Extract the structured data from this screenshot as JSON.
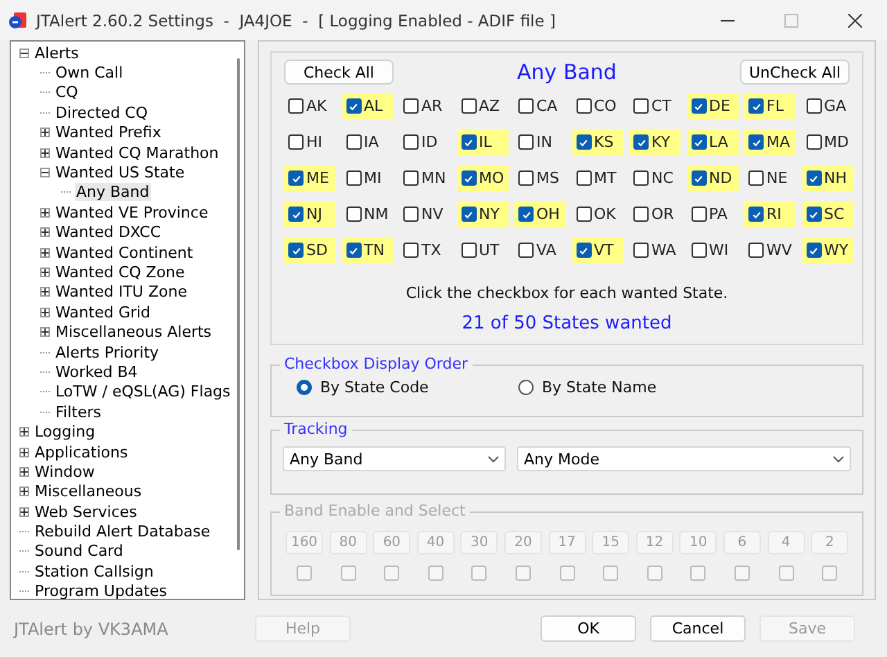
{
  "window": {
    "title": "JTAlert 2.60.2 Settings  -  JA4JOE  -  [ Logging Enabled - ADIF file ]"
  },
  "tree": [
    {
      "label": "Alerts",
      "expanded": true,
      "selected": false,
      "children": [
        {
          "label": "Own Call",
          "selected": false
        },
        {
          "label": "CQ",
          "selected": false
        },
        {
          "label": "Directed CQ",
          "selected": false
        },
        {
          "label": "Wanted Prefix",
          "expanded": false,
          "selected": false
        },
        {
          "label": "Wanted CQ Marathon",
          "expanded": false,
          "selected": false
        },
        {
          "label": "Wanted US State",
          "expanded": true,
          "selected": false,
          "children": [
            {
              "label": "Any Band",
              "selected": true
            }
          ]
        },
        {
          "label": "Wanted VE Province",
          "expanded": false,
          "selected": false
        },
        {
          "label": "Wanted DXCC",
          "expanded": false,
          "selected": false
        },
        {
          "label": "Wanted Continent",
          "expanded": false,
          "selected": false
        },
        {
          "label": "Wanted CQ Zone",
          "expanded": false,
          "selected": false
        },
        {
          "label": "Wanted ITU Zone",
          "expanded": false,
          "selected": false
        },
        {
          "label": "Wanted Grid",
          "expanded": false,
          "selected": false
        },
        {
          "label": "Miscellaneous Alerts",
          "expanded": false,
          "selected": false
        },
        {
          "label": "Alerts Priority",
          "selected": false
        },
        {
          "label": "Worked B4",
          "selected": false
        },
        {
          "label": "LoTW / eQSL(AG) Flags",
          "selected": false
        },
        {
          "label": "Filters",
          "selected": false
        }
      ]
    },
    {
      "label": "Logging",
      "expanded": false,
      "selected": false
    },
    {
      "label": "Applications",
      "expanded": false,
      "selected": false
    },
    {
      "label": "Window",
      "expanded": false,
      "selected": false
    },
    {
      "label": "Miscellaneous",
      "expanded": false,
      "selected": false
    },
    {
      "label": "Web Services",
      "expanded": false,
      "selected": false
    },
    {
      "label": "Rebuild Alert Database",
      "selected": false
    },
    {
      "label": "Sound Card",
      "selected": false
    },
    {
      "label": "Station Callsign",
      "selected": false
    },
    {
      "label": "Program Updates",
      "selected": false
    }
  ],
  "states_panel": {
    "check_all": "Check All",
    "heading": "Any Band",
    "uncheck_all": "UnCheck All",
    "states": [
      {
        "code": "AK",
        "checked": false
      },
      {
        "code": "AL",
        "checked": true
      },
      {
        "code": "AR",
        "checked": false
      },
      {
        "code": "AZ",
        "checked": false
      },
      {
        "code": "CA",
        "checked": false
      },
      {
        "code": "CO",
        "checked": false
      },
      {
        "code": "CT",
        "checked": false
      },
      {
        "code": "DE",
        "checked": true
      },
      {
        "code": "FL",
        "checked": true
      },
      {
        "code": "GA",
        "checked": false
      },
      {
        "code": "HI",
        "checked": false
      },
      {
        "code": "IA",
        "checked": false
      },
      {
        "code": "ID",
        "checked": false
      },
      {
        "code": "IL",
        "checked": true
      },
      {
        "code": "IN",
        "checked": false
      },
      {
        "code": "KS",
        "checked": true
      },
      {
        "code": "KY",
        "checked": true
      },
      {
        "code": "LA",
        "checked": true
      },
      {
        "code": "MA",
        "checked": true
      },
      {
        "code": "MD",
        "checked": false
      },
      {
        "code": "ME",
        "checked": true
      },
      {
        "code": "MI",
        "checked": false
      },
      {
        "code": "MN",
        "checked": false
      },
      {
        "code": "MO",
        "checked": true
      },
      {
        "code": "MS",
        "checked": false
      },
      {
        "code": "MT",
        "checked": false
      },
      {
        "code": "NC",
        "checked": false
      },
      {
        "code": "ND",
        "checked": true
      },
      {
        "code": "NE",
        "checked": false
      },
      {
        "code": "NH",
        "checked": true
      },
      {
        "code": "NJ",
        "checked": true
      },
      {
        "code": "NM",
        "checked": false
      },
      {
        "code": "NV",
        "checked": false
      },
      {
        "code": "NY",
        "checked": true
      },
      {
        "code": "OH",
        "checked": true
      },
      {
        "code": "OK",
        "checked": false
      },
      {
        "code": "OR",
        "checked": false
      },
      {
        "code": "PA",
        "checked": false
      },
      {
        "code": "RI",
        "checked": true
      },
      {
        "code": "SC",
        "checked": true
      },
      {
        "code": "SD",
        "checked": true
      },
      {
        "code": "TN",
        "checked": true
      },
      {
        "code": "TX",
        "checked": false
      },
      {
        "code": "UT",
        "checked": false
      },
      {
        "code": "VA",
        "checked": false
      },
      {
        "code": "VT",
        "checked": true
      },
      {
        "code": "WA",
        "checked": false
      },
      {
        "code": "WI",
        "checked": false
      },
      {
        "code": "WV",
        "checked": false
      },
      {
        "code": "WY",
        "checked": true
      }
    ],
    "hint": "Click the checkbox for each wanted State.",
    "summary": "21 of 50 States wanted"
  },
  "display_order": {
    "title": "Checkbox Display Order",
    "options": [
      {
        "label": "By State Code",
        "selected": true
      },
      {
        "label": "By State Name",
        "selected": false
      }
    ]
  },
  "tracking": {
    "title": "Tracking",
    "band": "Any Band",
    "mode": "Any Mode"
  },
  "band_select": {
    "title": "Band Enable and Select",
    "disabled": true,
    "bands": [
      {
        "label": "160",
        "checked": false
      },
      {
        "label": "80",
        "checked": false
      },
      {
        "label": "60",
        "checked": false
      },
      {
        "label": "40",
        "checked": false
      },
      {
        "label": "30",
        "checked": false
      },
      {
        "label": "20",
        "checked": false
      },
      {
        "label": "17",
        "checked": false
      },
      {
        "label": "15",
        "checked": false
      },
      {
        "label": "12",
        "checked": false
      },
      {
        "label": "10",
        "checked": false
      },
      {
        "label": "6",
        "checked": false
      },
      {
        "label": "4",
        "checked": false
      },
      {
        "label": "2",
        "checked": false
      }
    ]
  },
  "footer": {
    "credit": "JTAlert by VK3AMA",
    "buttons": [
      {
        "label": "Help",
        "disabled": true
      },
      {
        "label": "OK",
        "disabled": false
      },
      {
        "label": "Cancel",
        "disabled": false
      },
      {
        "label": "Save",
        "disabled": true
      }
    ]
  }
}
